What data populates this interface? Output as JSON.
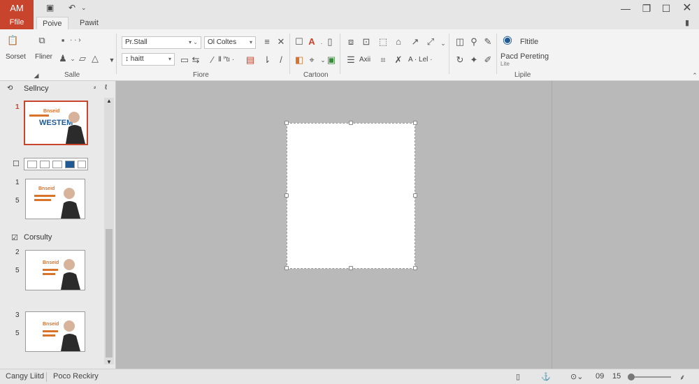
{
  "app": {
    "name": "AM",
    "file_tab": "Ffile"
  },
  "tabs": [
    {
      "label": "Poive",
      "active": true
    },
    {
      "label": "Pawit",
      "active": false
    }
  ],
  "ribbon": {
    "groups": [
      {
        "label": "Salle"
      },
      {
        "label": "Fiore"
      },
      {
        "label": "Cartoon"
      },
      {
        "label": "Lipile"
      }
    ],
    "clip_labels": {
      "sorset": "Sorset",
      "fliner": "Fliner"
    },
    "font_name": "Pr.Stall",
    "font_size": "↕ haitt",
    "color_dd": "Ol Coltes",
    "misc_label": "Ⅱ   ᑊ'tı ·",
    "arrange_label": "Axii",
    "tel_label": "A · Lel ·",
    "right_title": "Fltitle",
    "right_sub": "Pacd Pereting",
    "right_sub2": "Lite"
  },
  "sidebar": {
    "title": "Sellncy",
    "section_label": "Corsulty",
    "numbers": [
      "1",
      "1",
      "5",
      "2",
      "5",
      "3",
      "5"
    ],
    "thumb_text": {
      "small": "Bnseid",
      "big": "WESTEM"
    }
  },
  "statusbar": {
    "left1": "Cangy Liitd",
    "left2": "Poco Reckiry",
    "zoom_a": "09",
    "zoom_b": "15"
  },
  "colors": {
    "accent": "#c8442c",
    "orange": "#d9732a",
    "blue": "#1f5a96"
  },
  "icons": {
    "app": "app-logo",
    "save": "save-icon",
    "undo": "undo-icon",
    "minimize": "minimize-icon",
    "maximize": "maximize-icon",
    "close": "close-icon"
  }
}
